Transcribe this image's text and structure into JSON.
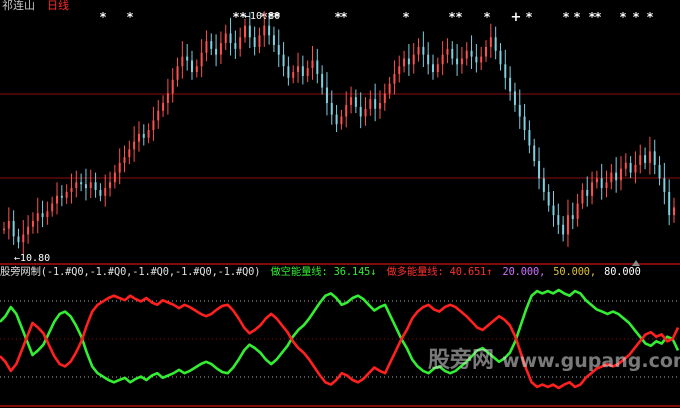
{
  "title": {
    "stock_name": "祁连山",
    "period": "日线"
  },
  "price": {
    "high_label": "←10.80",
    "low_label": "←10.80"
  },
  "indicator": {
    "formula": "股旁网制(-1.#Q0,-1.#Q0,-1.#Q0,-1.#Q0,-1.#Q0)",
    "short_label": "做空能量线: 36.145↓",
    "long_label": "做多能量线: 40.651↑",
    "lvl1": "20.000,",
    "lvl2": "50.000,",
    "lvl3": "80.000"
  },
  "watermark": {
    "brand": "股旁网",
    "url": "www.gupang.com"
  },
  "colors": {
    "background": "#000000",
    "up_candle": "#ff5050",
    "down_candle": "#7fd0e0",
    "short_line": "#33ee33",
    "long_line": "#ff2020",
    "grid_red": "#8a1010",
    "level_dots": "#aaaaaa"
  },
  "icons": {
    "signal_marker": "asterisk-glyph",
    "buy_marker": "plus-glyph",
    "scroll_marker": "triangle-up-icon"
  },
  "chart_data": [
    {
      "type": "candlestick",
      "title": "",
      "series": [
        {
          "name": "",
          "close": [
            10.5,
            10.9,
            10.1,
            9.8,
            10.2,
            10.6,
            10.9,
            11.3,
            11.1,
            11.4,
            11.8,
            12.2,
            12.1,
            12.4,
            12.6,
            12.9,
            12.8,
            12.6,
            12.9,
            12.5,
            12.2,
            12.6,
            12.9,
            13.4,
            13.9,
            14.2,
            14.6,
            15.0,
            15.4,
            15.2,
            15.6,
            16.1,
            16.6,
            17.0,
            17.5,
            18.2,
            18.9,
            19.4,
            19.2,
            18.6,
            18.9,
            19.6,
            20.2,
            19.8,
            19.5,
            20.1,
            20.6,
            20.1,
            19.8,
            20.4,
            21.0,
            20.4,
            19.9,
            20.5,
            21.0,
            20.5,
            20.0,
            19.5,
            18.9,
            18.3,
            18.6,
            18.9,
            18.4,
            18.8,
            19.2,
            18.5,
            17.8,
            17.0,
            16.4,
            15.9,
            16.3,
            16.9,
            17.3,
            16.8,
            16.3,
            16.7,
            17.2,
            16.7,
            17.0,
            17.5,
            18.0,
            18.5,
            18.9,
            19.3,
            19.0,
            19.5,
            19.9,
            19.5,
            19.0,
            18.6,
            19.0,
            19.5,
            19.8,
            19.3,
            19.0,
            19.3,
            19.7,
            19.4,
            19.1,
            19.4,
            19.9,
            20.4,
            19.7,
            19.0,
            18.3,
            17.6,
            16.9,
            16.3,
            15.6,
            14.8,
            14.0,
            13.1,
            12.4,
            11.7,
            11.2,
            10.7,
            10.2,
            11.2,
            11.0,
            11.8,
            12.5,
            12.2,
            12.9,
            13.1,
            12.6,
            12.9,
            13.4,
            13.0,
            13.6,
            13.9,
            13.4,
            13.8,
            14.3,
            13.9,
            14.5,
            13.8,
            13.1,
            12.4,
            11.2,
            11.6
          ]
        }
      ],
      "high_label": "10.80",
      "low_label": "10.80"
    },
    {
      "type": "line",
      "title": "",
      "ylim": [
        0,
        100
      ],
      "levels": [
        20,
        50,
        80
      ],
      "series": [
        {
          "name": "做空能量线",
          "values": [
            65,
            70,
            78,
            72,
            60,
            48,
            36,
            40,
            45,
            55,
            65,
            72,
            74,
            70,
            62,
            52,
            38,
            26,
            20,
            17,
            14,
            12,
            14,
            16,
            12,
            15,
            17,
            14,
            18,
            20,
            16,
            18,
            20,
            23,
            20,
            22,
            25,
            28,
            30,
            28,
            24,
            21,
            20,
            25,
            32,
            40,
            45,
            42,
            38,
            32,
            28,
            32,
            38,
            44,
            52,
            58,
            62,
            68,
            75,
            82,
            88,
            90,
            86,
            80,
            82,
            86,
            88,
            85,
            80,
            75,
            78,
            80,
            70,
            60,
            50,
            42,
            32,
            26,
            22,
            20,
            24,
            26,
            22,
            20,
            22,
            26,
            30,
            35,
            40,
            42,
            38,
            34,
            30,
            33,
            38,
            48,
            62,
            76,
            88,
            92,
            90,
            92,
            90,
            93,
            90,
            88,
            92,
            90,
            84,
            80,
            76,
            74,
            72,
            74,
            72,
            68,
            64,
            58,
            52,
            46,
            44,
            48,
            46,
            52,
            50,
            40
          ]
        },
        {
          "name": "做多能量线",
          "values": [
            35,
            30,
            22,
            28,
            40,
            52,
            64,
            60,
            55,
            45,
            35,
            28,
            26,
            30,
            38,
            48,
            62,
            74,
            80,
            83,
            86,
            88,
            86,
            84,
            88,
            85,
            83,
            86,
            82,
            80,
            84,
            82,
            80,
            77,
            80,
            78,
            75,
            72,
            70,
            72,
            76,
            79,
            80,
            75,
            68,
            60,
            55,
            58,
            62,
            68,
            72,
            68,
            62,
            56,
            48,
            42,
            38,
            32,
            25,
            18,
            12,
            10,
            14,
            20,
            18,
            14,
            12,
            15,
            20,
            25,
            22,
            20,
            30,
            40,
            50,
            58,
            68,
            74,
            78,
            80,
            76,
            74,
            78,
            80,
            78,
            74,
            70,
            65,
            60,
            58,
            62,
            66,
            70,
            67,
            62,
            52,
            38,
            24,
            12,
            8,
            10,
            8,
            10,
            7,
            10,
            12,
            8,
            10,
            16,
            20,
            24,
            26,
            28,
            26,
            28,
            32,
            36,
            42,
            48,
            54,
            56,
            52,
            54,
            48,
            50,
            60
          ]
        }
      ]
    }
  ]
}
